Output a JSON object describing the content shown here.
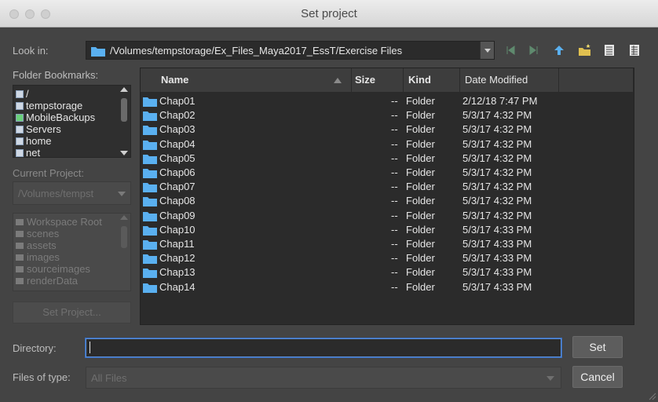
{
  "window": {
    "title": "Set project"
  },
  "look_in": {
    "label": "Look in:",
    "path": "/Volumes/tempstorage/Ex_Files_Maya2017_EssT/Exercise Files"
  },
  "toolbar": {
    "icons": [
      "back-icon",
      "forward-icon",
      "parent-directory-icon",
      "new-folder-icon",
      "list-view-icon",
      "detail-view-icon"
    ]
  },
  "bookmarks": {
    "label": "Folder Bookmarks:",
    "items": [
      "/",
      "tempstorage",
      "MobileBackups",
      "Servers",
      "home",
      "net"
    ]
  },
  "current_project": {
    "label": "Current Project:",
    "value": "/Volumes/tempst"
  },
  "workspace": {
    "items": [
      "Workspace Root",
      "scenes",
      "assets",
      "images",
      "sourceimages",
      "renderData"
    ]
  },
  "set_project_button": "Set Project...",
  "file_list": {
    "columns": [
      "Name",
      "Size",
      "Kind",
      "Date Modified"
    ],
    "rows": [
      {
        "name": "Chap01",
        "size": "--",
        "kind": "Folder",
        "date": "2/12/18 7:47 PM"
      },
      {
        "name": "Chap02",
        "size": "--",
        "kind": "Folder",
        "date": "5/3/17 4:32 PM"
      },
      {
        "name": "Chap03",
        "size": "--",
        "kind": "Folder",
        "date": "5/3/17 4:32 PM"
      },
      {
        "name": "Chap04",
        "size": "--",
        "kind": "Folder",
        "date": "5/3/17 4:32 PM"
      },
      {
        "name": "Chap05",
        "size": "--",
        "kind": "Folder",
        "date": "5/3/17 4:32 PM"
      },
      {
        "name": "Chap06",
        "size": "--",
        "kind": "Folder",
        "date": "5/3/17 4:32 PM"
      },
      {
        "name": "Chap07",
        "size": "--",
        "kind": "Folder",
        "date": "5/3/17 4:32 PM"
      },
      {
        "name": "Chap08",
        "size": "--",
        "kind": "Folder",
        "date": "5/3/17 4:32 PM"
      },
      {
        "name": "Chap09",
        "size": "--",
        "kind": "Folder",
        "date": "5/3/17 4:32 PM"
      },
      {
        "name": "Chap10",
        "size": "--",
        "kind": "Folder",
        "date": "5/3/17 4:33 PM"
      },
      {
        "name": "Chap11",
        "size": "--",
        "kind": "Folder",
        "date": "5/3/17 4:33 PM"
      },
      {
        "name": "Chap12",
        "size": "--",
        "kind": "Folder",
        "date": "5/3/17 4:33 PM"
      },
      {
        "name": "Chap13",
        "size": "--",
        "kind": "Folder",
        "date": "5/3/17 4:33 PM"
      },
      {
        "name": "Chap14",
        "size": "--",
        "kind": "Folder",
        "date": "5/3/17 4:33 PM"
      }
    ]
  },
  "directory": {
    "label": "Directory:",
    "value": ""
  },
  "files_of_type": {
    "label": "Files of type:",
    "value": "All Files"
  },
  "buttons": {
    "set": "Set",
    "cancel": "Cancel"
  },
  "colors": {
    "folder": "#5ab0f0",
    "accent_blue": "#3a6ebf",
    "background": "#444444",
    "list_bg": "#2b2b2b"
  }
}
